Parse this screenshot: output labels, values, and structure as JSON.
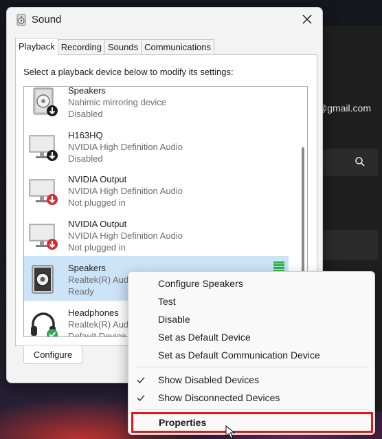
{
  "background": {
    "email_fragment": "@gmail.com",
    "search_icon": "search-icon"
  },
  "dialog": {
    "title": "Sound",
    "title_icon": "speaker-icon",
    "close_icon": "close-icon",
    "tabs": [
      {
        "label": "Playback",
        "active": true
      },
      {
        "label": "Recording",
        "active": false
      },
      {
        "label": "Sounds",
        "active": false
      },
      {
        "label": "Communications",
        "active": false
      }
    ],
    "instruction": "Select a playback device below to modify its settings:",
    "devices": [
      {
        "name": "Speakers",
        "description": "Nahimic mirroring device",
        "status": "Disabled",
        "icon": "speaker-box-icon",
        "badge": "disabled-arrow-badge"
      },
      {
        "name": "H163HQ",
        "description": "NVIDIA High Definition Audio",
        "status": "Disabled",
        "icon": "monitor-icon",
        "badge": "disabled-arrow-badge"
      },
      {
        "name": "NVIDIA Output",
        "description": "NVIDIA High Definition Audio",
        "status": "Not plugged in",
        "icon": "monitor-icon",
        "badge": "unplugged-arrow-badge"
      },
      {
        "name": "NVIDIA Output",
        "description": "NVIDIA High Definition Audio",
        "status": "Not plugged in",
        "icon": "monitor-icon",
        "badge": "unplugged-arrow-badge"
      },
      {
        "name": "Speakers",
        "description": "Realtek(R) Audio",
        "status": "Ready",
        "icon": "speaker-box-icon",
        "selected": true,
        "level_meter": true
      },
      {
        "name": "Headphones",
        "description": "Realtek(R) Audio",
        "status": "Default Device",
        "icon": "headphones-icon",
        "badge": "default-check-badge"
      }
    ],
    "configure_label": "Configure"
  },
  "context_menu": {
    "items": [
      {
        "label": "Configure Speakers"
      },
      {
        "label": "Test"
      },
      {
        "label": "Disable"
      },
      {
        "label": "Set as Default Device"
      },
      {
        "label": "Set as Default Communication Device"
      }
    ],
    "toggles": [
      {
        "label": "Show Disabled Devices",
        "checked": true
      },
      {
        "label": "Show Disconnected Devices",
        "checked": true
      }
    ],
    "properties_label": "Properties",
    "highlight_color": "#e2181f"
  },
  "colors": {
    "selection": "#cce4f7",
    "level_meter": "#2fb34a",
    "unplugged_badge": "#d32f2f",
    "default_badge": "#2fa84f"
  }
}
